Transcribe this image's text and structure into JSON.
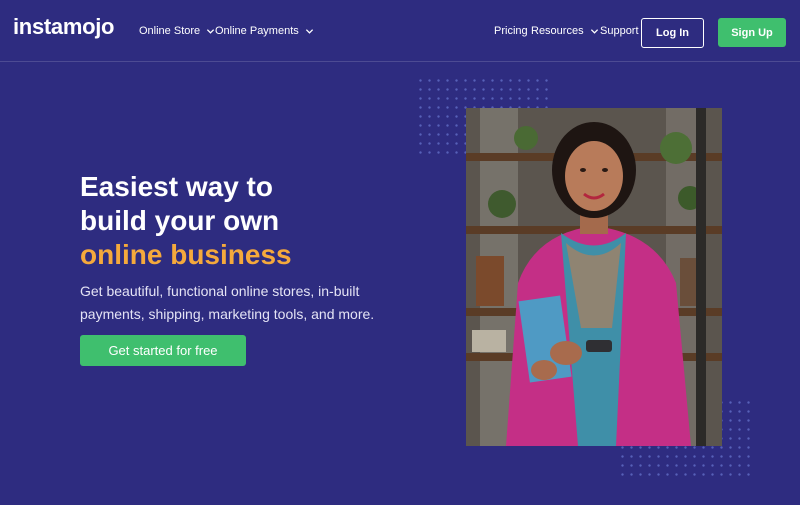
{
  "header": {
    "logo_text": "instamojo",
    "nav_left": [
      {
        "label": "Online Store",
        "icon": "chevron-down-icon"
      },
      {
        "label": "Online Payments",
        "icon": "chevron-down-icon"
      }
    ],
    "nav_right": [
      {
        "label": "Pricing"
      },
      {
        "label": "Resources",
        "icon": "chevron-down-icon"
      },
      {
        "label": "Support"
      }
    ],
    "login_label": "Log In",
    "signup_label": "Sign Up"
  },
  "hero": {
    "title_line1": "Easiest way to",
    "title_line2": "build your own",
    "title_accent": "online business",
    "subtitle_line1": "Get beautiful, functional online stores, in-built",
    "subtitle_line2": "payments, shipping, marketing tools, and more.",
    "cta_label": "Get started for free"
  },
  "colors": {
    "background": "#2e2c80",
    "accent_orange": "#f5a93c",
    "button_green": "#3fbf6e",
    "text_white": "#ffffff"
  }
}
